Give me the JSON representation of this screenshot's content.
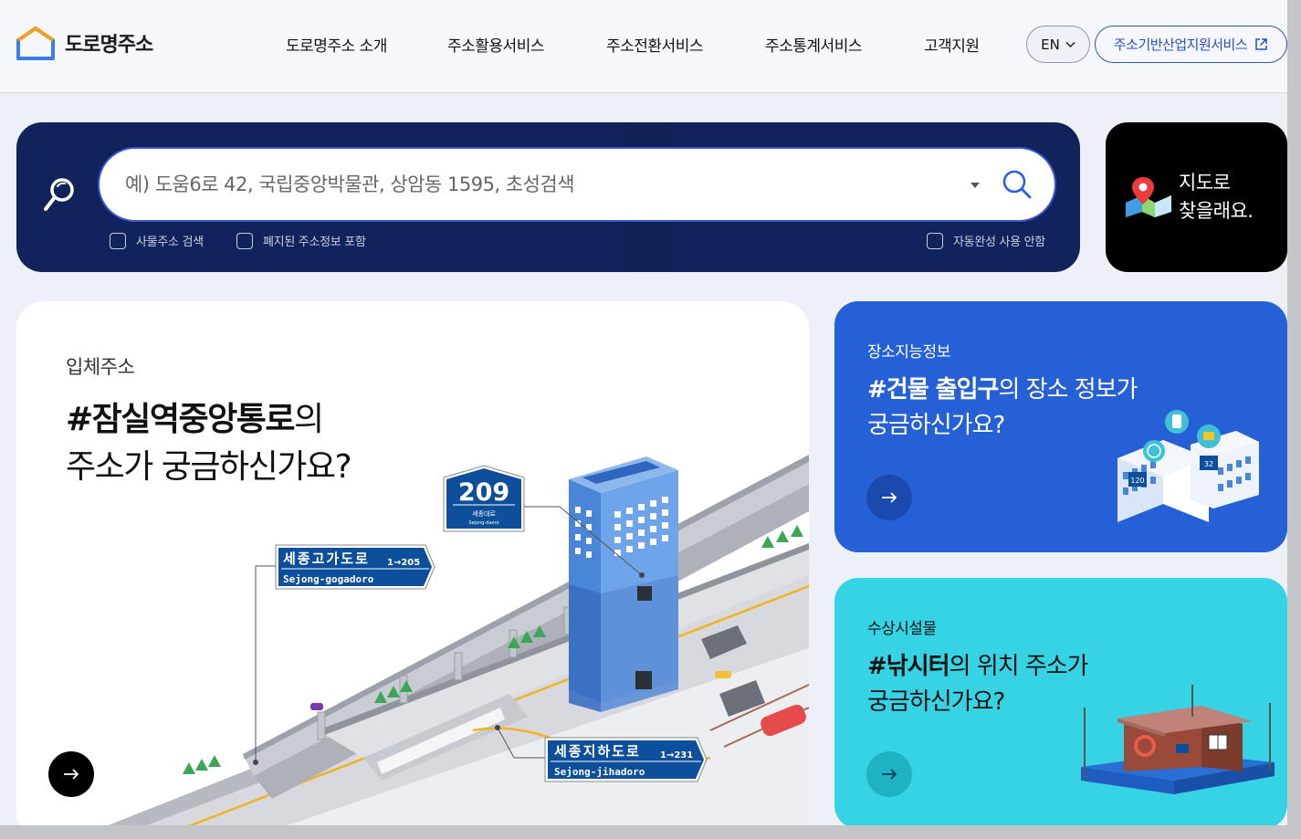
{
  "header": {
    "logo_text": "도로명주소",
    "nav": [
      "도로명주소 소개",
      "주소활용서비스",
      "주소전환서비스",
      "주소통계서비스",
      "고객지원"
    ],
    "lang_label": "EN",
    "service_label": "주소기반산업지원서비스"
  },
  "search": {
    "placeholder": "예) 도움6로 42, 국립중앙박물관, 상암동 1595, 초성검색",
    "options": {
      "building": "사물주소 검색",
      "abolished": "폐지된 주소정보 포함",
      "autocomplete": "자동완성 사용 안함"
    }
  },
  "map_card": {
    "line1": "지도로",
    "line2": "찾을래요."
  },
  "feature_card": {
    "kicker": "입체주소",
    "title_highlight": "#잠실역중앙통로",
    "title_rest": "의",
    "title_line2": "주소가 궁금하신가요?",
    "illustration": {
      "sign_209_number": "209",
      "sign_209_kor": "세종대로",
      "sign_209_eng": "Sejong-daero",
      "sign_gogadoro_kor": "세종고가도로",
      "sign_gogadoro_eng": "Sejong-gogadoro",
      "sign_gogadoro_range": "1→205",
      "sign_jihadoro_kor": "세종지하도로",
      "sign_jihadoro_eng": "Sejong-jihadoro",
      "sign_jihadoro_range": "1→231"
    }
  },
  "card_place": {
    "kicker": "장소지능정보",
    "title_highlight": "#건물 출입구",
    "title_rest": "의 장소 정보가",
    "title_line2": "궁금하신가요?",
    "badge_1": "120",
    "badge_2": "32"
  },
  "card_water": {
    "kicker": "수상시설물",
    "title_highlight": "#낚시터",
    "title_rest": "의 위치 주소가",
    "title_line2": "궁금하신가요?"
  },
  "colors": {
    "primary_navy": "#10245b",
    "accent_blue": "#2560d7",
    "accent_cyan": "#35d3e3",
    "sign_blue": "#0d4f9a"
  }
}
